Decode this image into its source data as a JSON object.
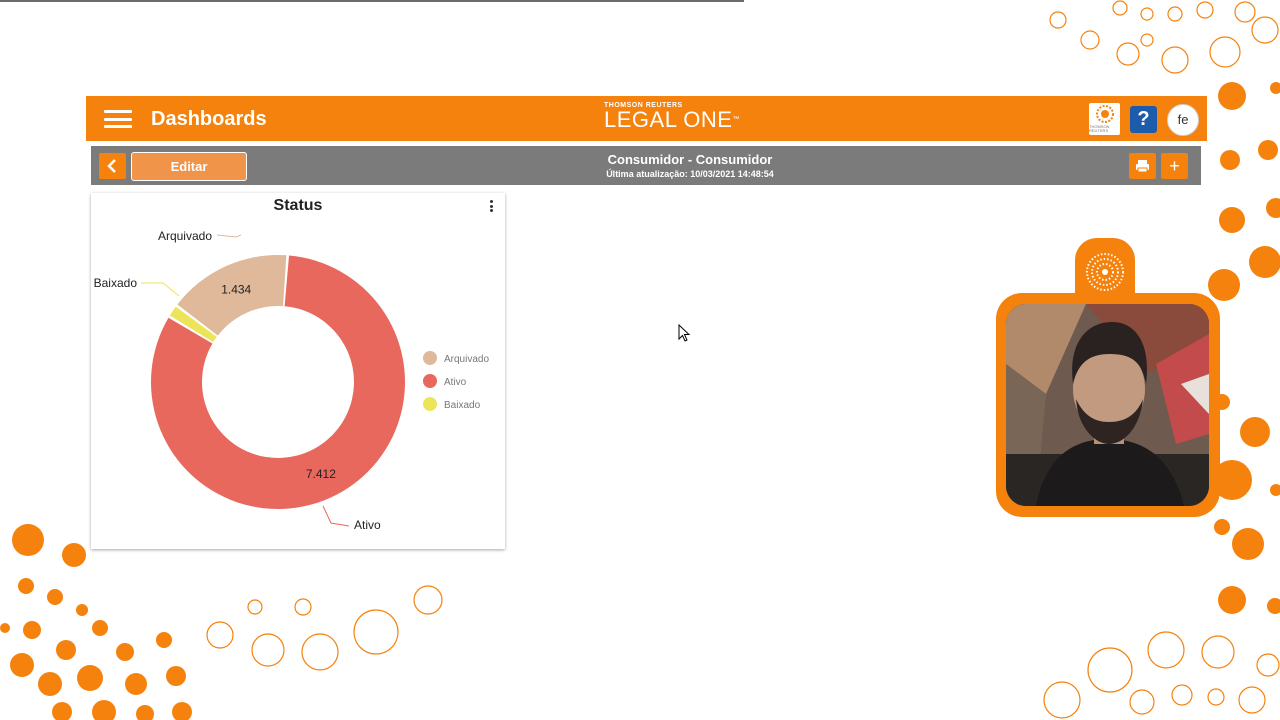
{
  "header": {
    "title": "Dashboards",
    "brand_top": "THOMSON REUTERS",
    "brand_main": "LEGAL ONE",
    "brand_tm": "™",
    "tr_logo_text": "THOMSON REUTERS",
    "help_label": "?",
    "user_initials": "fe"
  },
  "toolbar": {
    "edit_label": "Editar",
    "title": "Consumidor - Consumidor",
    "updated": "Última atualização: 10/03/2021 14:48:54",
    "add_label": "+"
  },
  "card": {
    "title": "Status"
  },
  "chart_data": {
    "type": "pie",
    "title": "Status",
    "donut": true,
    "categories": [
      "Arquivado",
      "Ativo",
      "Baixado"
    ],
    "values": [
      1434,
      7412,
      150
    ],
    "value_labels": [
      "1.434",
      "7.412",
      ""
    ],
    "colors": [
      "#e0b89a",
      "#e8685e",
      "#ece55a"
    ],
    "legend": {
      "placement": "right",
      "entries": [
        "Arquivado",
        "Ativo",
        "Baixado"
      ]
    }
  },
  "colors": {
    "accent": "#f5820d",
    "toolbar_bg": "#7b7b7b",
    "help": "#1d5cab"
  }
}
